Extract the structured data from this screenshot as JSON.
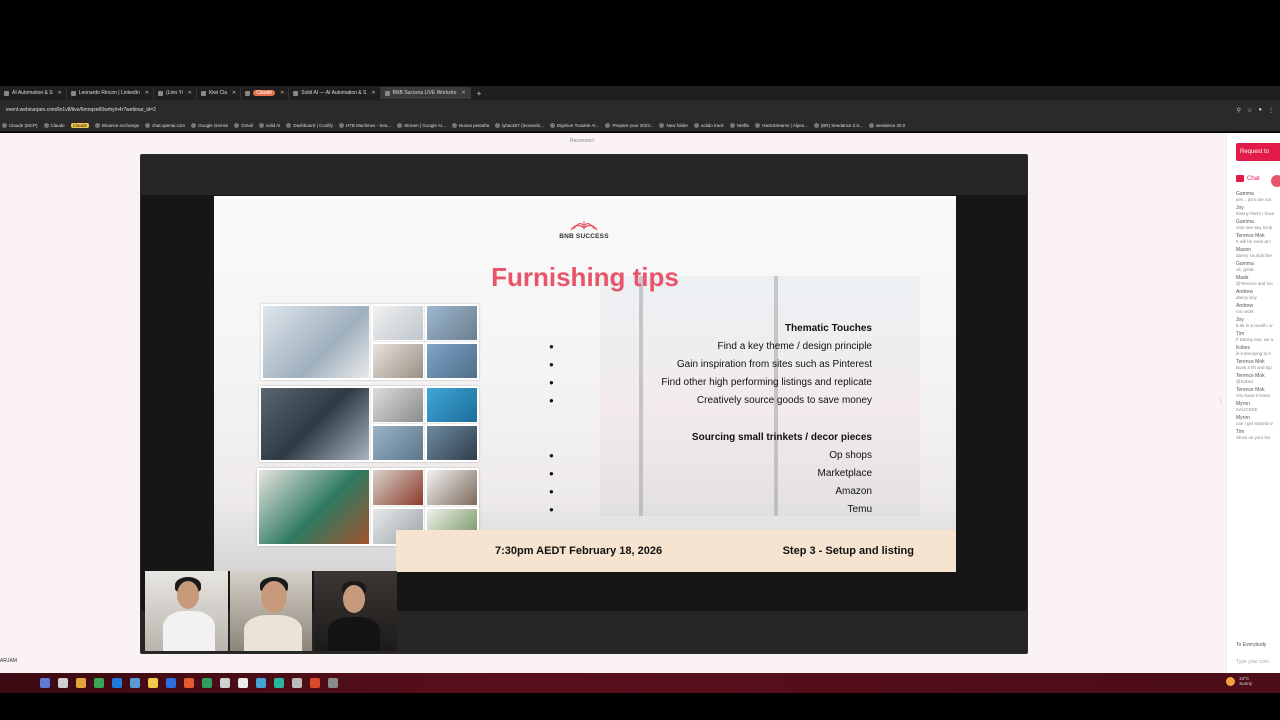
{
  "browser": {
    "tabs": [
      {
        "label": "AI Automation & S",
        "active": false
      },
      {
        "label": "Leonardo Rincon | LinkedIn",
        "active": false
      },
      {
        "label": "(Linn Yi",
        "active": false
      },
      {
        "label": "Kiwi Cla",
        "active": false
      },
      {
        "label": "Claude",
        "active": false,
        "pill": true
      },
      {
        "label": "Solid AI — AI Automation & S",
        "active": false
      },
      {
        "label": "BNB Success LIVE Worksho",
        "active": true
      }
    ],
    "url": "event.webinarjam.com/llo1v8/live/6mnqxe60wrhy/n4r?webinar_id=2",
    "bookmarks": [
      {
        "label": "Claude (MCP)",
        "pill": false
      },
      {
        "label": "Claude",
        "pill": false
      },
      {
        "label": "Claude",
        "pill": true
      },
      {
        "label": "Binance exchange",
        "pill": false
      },
      {
        "label": "chat.openai.com",
        "pill": false
      },
      {
        "label": "Google Gemini",
        "pill": false
      },
      {
        "label": "Gmail",
        "pill": false
      },
      {
        "label": "solid AI",
        "pill": false
      },
      {
        "label": "Dashboard | Coolify",
        "pill": false
      },
      {
        "label": "HTB Machines - Sea...",
        "pill": false
      },
      {
        "label": "Stream | Google AI...",
        "pill": false
      },
      {
        "label": "Nuova pestaña",
        "pill": false
      },
      {
        "label": "lyhack07 (leonardo...",
        "pill": false
      },
      {
        "label": "Digimon Tusukte Ar...",
        "pill": false
      },
      {
        "label": "Prepare your 2023...",
        "pill": false
      },
      {
        "label": "New folder",
        "pill": false
      },
      {
        "label": "solido track",
        "pill": false
      },
      {
        "label": "Netflix",
        "pill": false
      },
      {
        "label": "HackStreams | Alpes...",
        "pill": false
      },
      {
        "label": "(BR) Seedance 2.0...",
        "pill": false
      },
      {
        "label": "seedance 20.0",
        "pill": false
      }
    ]
  },
  "page": {
    "reconnect": "Reconnect",
    "side_text": "ARJAM"
  },
  "slide": {
    "logo_text": "BNB SUCCESS",
    "title": "Furnishing tips",
    "section1": {
      "heading": "Thematic Touches",
      "items": [
        "Find a key theme / design principle",
        "Gain inspiration from sites such as Pinterest",
        "Find other high performing listings and replicate",
        "Creatively source goods to save money"
      ]
    },
    "section2": {
      "heading": "Sourcing small trinkets / decor pieces",
      "items": [
        "Op shops",
        "Marketplace",
        "Amazon",
        "Temu"
      ]
    },
    "footer_left": "7:30pm AEDT February 18, 2026",
    "footer_right": "Step 3 - Setup and listing"
  },
  "chat": {
    "request_button": "Request to",
    "tab_label": "Chat",
    "messages": [
      {
        "name": "Gamma",
        "text": "yes .. pics are not"
      },
      {
        "name": "Joy",
        "text": "Danny that's I have"
      },
      {
        "name": "Gamma",
        "text": "cant see any scrip"
      },
      {
        "name": "Terence Mok",
        "text": "It will be even at t"
      },
      {
        "name": "Mason",
        "text": "danny sounds like"
      },
      {
        "name": "Gamma",
        "text": "ok, great."
      },
      {
        "name": "Made",
        "text": "@Terence and Ivo"
      },
      {
        "name": "Andrew",
        "text": "danny boy"
      },
      {
        "name": "Andrew",
        "text": "mic work"
      },
      {
        "name": "Joy",
        "text": "6.5k in a month, w"
      },
      {
        "name": "Tim",
        "text": "If Danny can, we a"
      },
      {
        "name": "Kobez",
        "text": "is it annoying to h"
      },
      {
        "name": "Terence Mok",
        "text": "Book a lift and typ"
      },
      {
        "name": "Terence Mok",
        "text": "@Kobez"
      },
      {
        "name": "Terence Mok",
        "text": "You have it lease"
      },
      {
        "name": "Myron",
        "text": "SAUCEEE"
      },
      {
        "name": "Myron",
        "text": "can I get started w"
      },
      {
        "name": "Tim",
        "text": "Show us your list"
      }
    ],
    "to_everybody": "To Everybody",
    "type_placeholder": "Type your com"
  },
  "taskbar": {
    "weather_temp": "24°C",
    "weather_place": "Sunny"
  },
  "colors": {
    "accent": "#e21b4a",
    "title_pink": "#e8546a",
    "footer_bg": "#f6e4d1"
  }
}
